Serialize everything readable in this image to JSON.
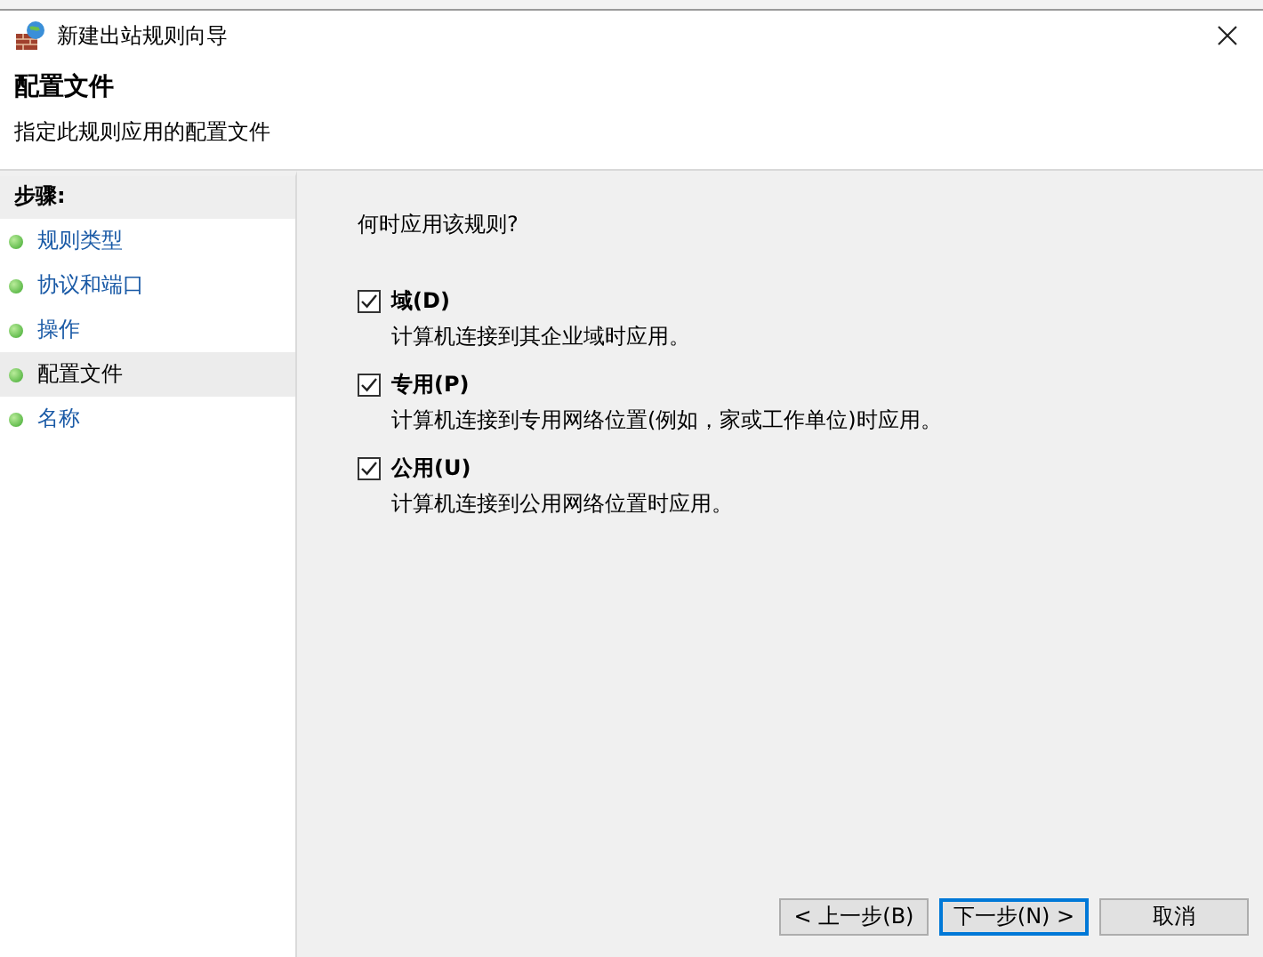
{
  "window": {
    "title": "新建出站规则向导"
  },
  "header": {
    "title": "配置文件",
    "subtitle": "指定此规则应用的配置文件"
  },
  "steps": {
    "heading": "步骤:",
    "items": [
      {
        "label": "规则类型",
        "selected": false
      },
      {
        "label": "协议和端口",
        "selected": false
      },
      {
        "label": "操作",
        "selected": false
      },
      {
        "label": "配置文件",
        "selected": true
      },
      {
        "label": "名称",
        "selected": false
      }
    ]
  },
  "question": "何时应用该规则?",
  "options": [
    {
      "label": "域(D)",
      "description": "计算机连接到其企业域时应用。",
      "checked": true
    },
    {
      "label": "专用(P)",
      "description": "计算机连接到专用网络位置(例如，家或工作单位)时应用。",
      "checked": true
    },
    {
      "label": "公用(U)",
      "description": "计算机连接到公用网络位置时应用。",
      "checked": true
    }
  ],
  "buttons": [
    {
      "label": "< 上一步(B)",
      "default": false
    },
    {
      "label": "下一步(N) >",
      "default": true
    },
    {
      "label": "取消",
      "default": false
    }
  ]
}
